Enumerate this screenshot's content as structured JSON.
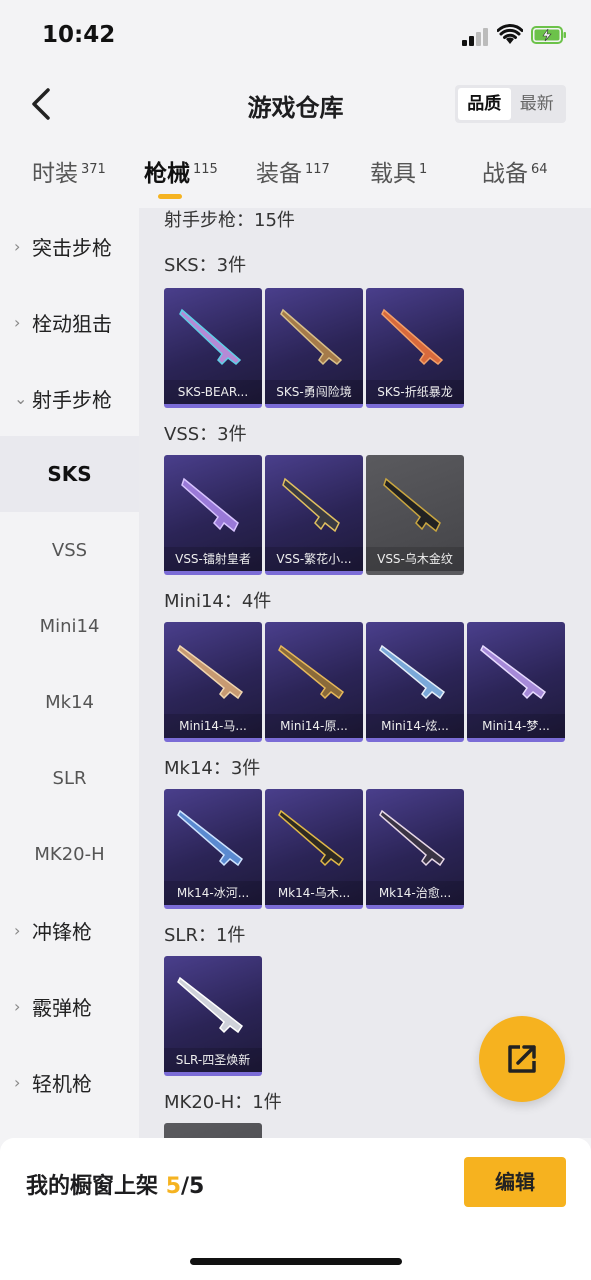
{
  "status_bar": {
    "time": "10:42"
  },
  "header": {
    "title": "游戏仓库",
    "sort_options": [
      "品质",
      "最新"
    ],
    "selected_sort": "品质"
  },
  "tabs": [
    {
      "label": "时装",
      "count": "371"
    },
    {
      "label": "枪械",
      "count": "115"
    },
    {
      "label": "装备",
      "count": "117"
    },
    {
      "label": "载具",
      "count": "1"
    },
    {
      "label": "战备",
      "count": "64"
    }
  ],
  "sidebar": {
    "items": [
      {
        "label": "突击步枪",
        "type": "category"
      },
      {
        "label": "栓动狙击",
        "type": "category"
      },
      {
        "label": "射手步枪",
        "type": "category",
        "expanded": true
      },
      {
        "label": "SKS",
        "type": "sub",
        "selected": true
      },
      {
        "label": "VSS",
        "type": "sub"
      },
      {
        "label": "Mini14",
        "type": "sub"
      },
      {
        "label": "Mk14",
        "type": "sub"
      },
      {
        "label": "SLR",
        "type": "sub"
      },
      {
        "label": "MK20-H",
        "type": "sub"
      },
      {
        "label": "冲锋枪",
        "type": "category"
      },
      {
        "label": "霰弹枪",
        "type": "category"
      },
      {
        "label": "轻机枪",
        "type": "category"
      }
    ]
  },
  "content": {
    "category_header": "射手步枪：15件",
    "groups": [
      {
        "label": "SKS：3件",
        "items": [
          "SKS-BEAR...",
          "SKS-勇闯险境",
          "SKS-折纸暴龙"
        ]
      },
      {
        "label": "VSS：3件",
        "items": [
          "VSS-镭射皇者",
          "VSS-繁花小...",
          "VSS-乌木金纹"
        ]
      },
      {
        "label": "Mini14：4件",
        "items": [
          "Mini14-马...",
          "Mini14-原...",
          "Mini14-炫...",
          "Mini14-梦..."
        ]
      },
      {
        "label": "Mk14：3件",
        "items": [
          "Mk14-冰河...",
          "Mk14-乌木...",
          "Mk14-治愈..."
        ]
      },
      {
        "label": "SLR：1件",
        "items": [
          "SLR-四圣焕新"
        ]
      },
      {
        "label": "MK20-H：1件",
        "items": []
      }
    ]
  },
  "bottom_bar": {
    "shelf_label": "我的橱窗上架",
    "shelf_current": "5",
    "shelf_total": "/5",
    "edit_label": "编辑"
  },
  "colors": {
    "accent": "#f5b321",
    "card_purple": "#2b2456",
    "card_gray": "#4e4e52"
  },
  "icons": [
    "back-arrow-icon",
    "external-link-icon"
  ]
}
